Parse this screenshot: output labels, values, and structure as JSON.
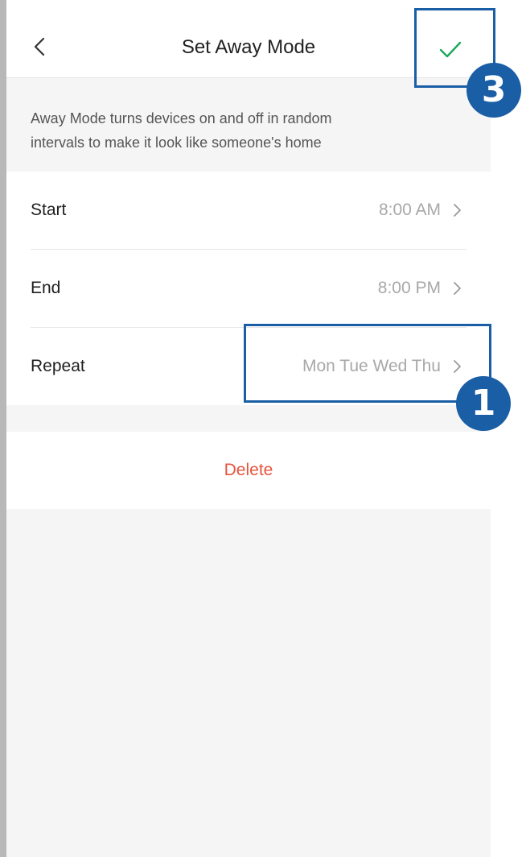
{
  "header": {
    "title": "Set Away Mode",
    "back_icon": "chevron-left-icon",
    "confirm_icon": "checkmark-icon"
  },
  "description": {
    "line1": "Away Mode turns devices on and off in random",
    "line2": "intervals to make it look like someone's home"
  },
  "settings": {
    "rows": [
      {
        "label": "Start",
        "value": "8:00 AM"
      },
      {
        "label": "End",
        "value": "8:00 PM"
      },
      {
        "label": "Repeat",
        "value": "Mon Tue Wed Thu"
      }
    ]
  },
  "delete_label": "Delete",
  "annotations": {
    "badge_confirm": "3",
    "badge_repeat": "1"
  },
  "colors": {
    "accent_check": "#1aa85c",
    "delete_red": "#e8533e",
    "annotation_blue": "#1a5ea6"
  }
}
